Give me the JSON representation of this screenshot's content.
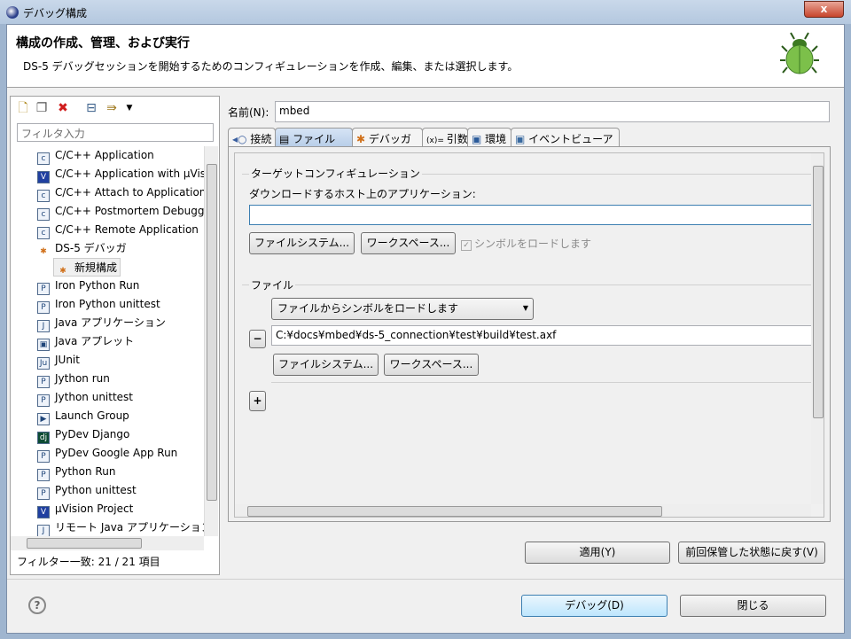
{
  "window": {
    "title": "デバッグ構成",
    "close": "x"
  },
  "header": {
    "title": "構成の作成、管理、および実行",
    "subtitle": "DS-5 デバッグセッションを開始するためのコンフィギュレーションを作成、編集、または選択します。"
  },
  "left": {
    "toolbar": [
      "new-config-icon",
      "duplicate-icon",
      "delete-icon",
      "collapse-all-icon",
      "filter-icon",
      "menu-chevron-icon"
    ],
    "filter_placeholder": "フィルタ入力",
    "items": [
      {
        "label": "C/C++ Application",
        "icon": "c-app-icon",
        "level": 0
      },
      {
        "label": "C/C++ Application with µVision",
        "icon": "uvision-icon",
        "level": 0
      },
      {
        "label": "C/C++ Attach to Application",
        "icon": "c-app-icon",
        "level": 0
      },
      {
        "label": "C/C++ Postmortem Debugger",
        "icon": "c-app-icon",
        "level": 0
      },
      {
        "label": "C/C++ Remote Application",
        "icon": "c-app-icon",
        "level": 0
      },
      {
        "label": "DS-5 デバッガ",
        "icon": "bug-icon",
        "level": 0
      },
      {
        "label": "新規構成",
        "icon": "bug-icon",
        "level": 1,
        "selected": true
      },
      {
        "label": "Iron Python Run",
        "icon": "python-icon",
        "level": 0
      },
      {
        "label": "Iron Python unittest",
        "icon": "python-icon",
        "level": 0
      },
      {
        "label": "Java アプリケーション",
        "icon": "java-icon",
        "level": 0
      },
      {
        "label": "Java アプレット",
        "icon": "applet-icon",
        "level": 0
      },
      {
        "label": "JUnit",
        "icon": "junit-icon",
        "level": 0
      },
      {
        "label": "Jython run",
        "icon": "python-icon",
        "level": 0
      },
      {
        "label": "Jython unittest",
        "icon": "python-icon",
        "level": 0
      },
      {
        "label": "Launch Group",
        "icon": "launch-icon",
        "level": 0
      },
      {
        "label": "PyDev Django",
        "icon": "django-icon",
        "level": 0
      },
      {
        "label": "PyDev Google App Run",
        "icon": "python-icon",
        "level": 0
      },
      {
        "label": "Python Run",
        "icon": "python-icon",
        "level": 0
      },
      {
        "label": "Python unittest",
        "icon": "python-icon",
        "level": 0
      },
      {
        "label": "µVision Project",
        "icon": "uvision-icon",
        "level": 0
      },
      {
        "label": "リモート Java アプリケーション",
        "icon": "java-icon",
        "level": 0
      }
    ],
    "filter_count": "フィルター一致: 21 / 21 項目"
  },
  "config": {
    "name_label": "名前(N):",
    "name_value": "mbed",
    "tabs": [
      {
        "label": "接続",
        "icon": "connection-icon"
      },
      {
        "label": "ファイル",
        "icon": "file-icon",
        "selected": true
      },
      {
        "label": "デバッガ",
        "icon": "bug-icon"
      },
      {
        "label": "引数",
        "icon": "arguments-icon"
      },
      {
        "label": "環境",
        "icon": "environment-icon"
      },
      {
        "label": "イベントビューア",
        "icon": "event-viewer-icon"
      }
    ],
    "target_group": "ターゲットコンフィギュレーション",
    "download_label": "ダウンロードするホスト上のアプリケーション:",
    "download_value": "",
    "filesystem": "ファイルシステム...",
    "workspace": "ワークスペース...",
    "load_symbols": "シンボルをロードします",
    "files_group": "ファイル",
    "file_mode": "ファイルからシンボルをロードします",
    "file_path": "C:¥docs¥mbed¥ds-5_connection¥test¥build¥test.axf",
    "remove": "−",
    "add": "+"
  },
  "buttons": {
    "apply": "適用(Y)",
    "revert": "前回保管した状態に戻す(V)",
    "debug": "デバッグ(D)",
    "close": "閉じる",
    "help": "?"
  }
}
